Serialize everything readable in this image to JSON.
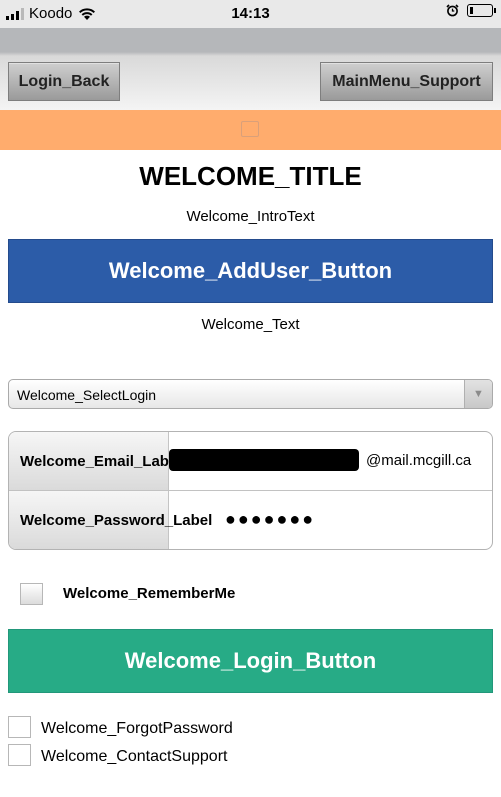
{
  "status_bar": {
    "carrier": "Koodo",
    "time": "14:13",
    "wifi_icon": "wifi-icon",
    "alarm_icon": "alarm-clock-icon",
    "battery_icon": "battery-icon"
  },
  "nav": {
    "back_label": "Login_Back",
    "support_label": "MainMenu_Support",
    "header_color": "#ffac6d"
  },
  "welcome": {
    "title": "WELCOME_TITLE",
    "intro": "Welcome_IntroText",
    "add_user_label": "Welcome_AddUser_Button",
    "add_user_color": "#2c5ca8",
    "text": "Welcome_Text",
    "select_login": "Welcome_SelectLogin",
    "email_label": "Welcome_Email_Label",
    "email_value_visible": "@mail.mcgill.ca",
    "password_label": "Welcome_Password_Label",
    "password_value": "●●●●●●●",
    "remember_me": "Welcome_RememberMe",
    "login_label": "Welcome_Login_Button",
    "login_color": "#27ab86",
    "forgot_password": "Welcome_ForgotPassword",
    "contact_support": "Welcome_ContactSupport"
  }
}
